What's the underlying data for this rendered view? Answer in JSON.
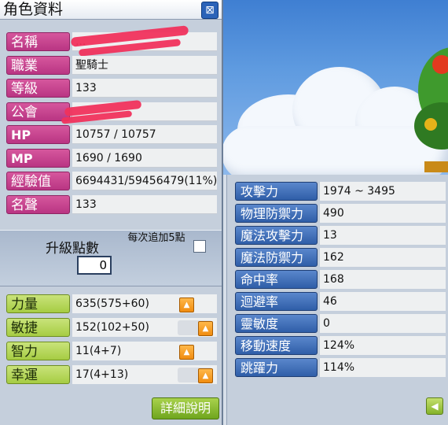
{
  "window": {
    "title": "角色資料",
    "close_icon": "close-x-icon"
  },
  "profile": [
    {
      "label": "名稱",
      "value": "...",
      "redacted": true
    },
    {
      "label": "職業",
      "value": "聖騎士"
    },
    {
      "label": "等級",
      "value": "133"
    },
    {
      "label": "公會",
      "value": "",
      "redacted": true
    },
    {
      "label": "HP",
      "value": "10757 / 10757"
    },
    {
      "label": "MP",
      "value": "1690 / 1690"
    },
    {
      "label": "經驗值",
      "value": "6694431/59456479(11%)"
    },
    {
      "label": "名聲",
      "value": "133"
    }
  ],
  "ability_points": {
    "label": "升級點數",
    "value": "0",
    "auto_add": "每次追加5點",
    "checked": false
  },
  "attributes": [
    {
      "label": "力量",
      "value": "635(575+60)",
      "plus_icon": "up-arrow-icon"
    },
    {
      "label": "敏捷",
      "value": "152(102+50)",
      "plus_icon": "up-arrow-icon"
    },
    {
      "label": "智力",
      "value": "11(4+7)",
      "plus_icon": "up-arrow-icon"
    },
    {
      "label": "幸運",
      "value": "17(4+13)",
      "plus_icon": "up-arrow-icon"
    }
  ],
  "detail_button": "詳細說明",
  "combat_stats": [
    {
      "label": "攻擊力",
      "value": "1974 ~ 3495"
    },
    {
      "label": "物理防禦力",
      "value": "490"
    },
    {
      "label": "魔法攻擊力",
      "value": "13"
    },
    {
      "label": "魔法防禦力",
      "value": "162"
    },
    {
      "label": "命中率",
      "value": "168"
    },
    {
      "label": "迴避率",
      "value": "46"
    },
    {
      "label": "靈敏度",
      "value": "0"
    },
    {
      "label": "移動速度",
      "value": "124%"
    },
    {
      "label": "跳躍力",
      "value": "114%"
    }
  ],
  "back_icon": "back-arrow-icon",
  "colors": {
    "profile_label": "#c2418d",
    "attr_label": "#a6cc43",
    "combat_label": "#3b68b3",
    "redaction": "#f0325c"
  }
}
